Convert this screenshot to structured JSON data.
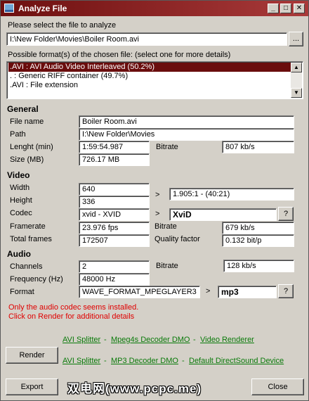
{
  "window": {
    "title": "Analyze File",
    "controls": {
      "minimize": "_",
      "maximize": "□",
      "close": "✕"
    }
  },
  "file": {
    "prompt": "Please select the file to analyze",
    "path_value": "I:\\New Folder\\Movies\\Boiler Room.avi",
    "browse_label": "..."
  },
  "formats": {
    "prompt": "Possible format(s) of the chosen file: (select one for more details)",
    "items": [
      ".AVI : AVI Audio Video Interleaved (50.2%)",
      ". : Generic RIFF container (49.7%)",
      ".AVI : File extension"
    ],
    "selected_index": 0
  },
  "general": {
    "heading": "General",
    "file_name_label": "File name",
    "file_name": "Boiler Room.avi",
    "path_label": "Path",
    "path": "I:\\New Folder\\Movies",
    "length_label": "Lenght (min)",
    "length": "1:59:54.987",
    "bitrate_label": "Bitrate",
    "bitrate": "807 kb/s",
    "size_label": "Size (MB)",
    "size": "726.17 MB"
  },
  "video": {
    "heading": "Video",
    "width_label": "Width",
    "width": "640",
    "height_label": "Height",
    "height": "336",
    "aspect_arrow": ">",
    "aspect": "1.905:1 - (40:21)",
    "codec_label": "Codec",
    "codec": "xvid - XVID",
    "codec_arrow": ">",
    "codec_name": "XviD",
    "codec_help": "?",
    "framerate_label": "Framerate",
    "framerate": "23.976 fps",
    "bitrate_label": "Bitrate",
    "bitrate": "679 kb/s",
    "frames_label": "Total frames",
    "frames": "172507",
    "quality_label": "Quality factor",
    "quality": "0.132 bit/p"
  },
  "audio": {
    "heading": "Audio",
    "channels_label": "Channels",
    "channels": "2",
    "bitrate_label": "Bitrate",
    "bitrate": "128 kb/s",
    "frequency_label": "Frequency (Hz)",
    "frequency": "48000 Hz",
    "format_label": "Format",
    "format": "WAVE_FORMAT_MPEGLAYER3",
    "format_arrow": ">",
    "format_name": "mp3",
    "format_help": "?"
  },
  "status": {
    "line1": "Only the audio codec seems installed.",
    "line2": "Click on Render for additional details"
  },
  "render": {
    "button_label": "Render",
    "video_chain": [
      "AVI Splitter",
      "Mpeg4s Decoder DMO",
      "Video Renderer"
    ],
    "audio_chain": [
      "AVI Splitter",
      "MP3 Decoder DMO",
      "Default DirectSound Device"
    ],
    "separator": "-"
  },
  "footer": {
    "export_label": "Export",
    "close_label": "Close",
    "watermark": "双电网(www.pcpc.me)"
  }
}
